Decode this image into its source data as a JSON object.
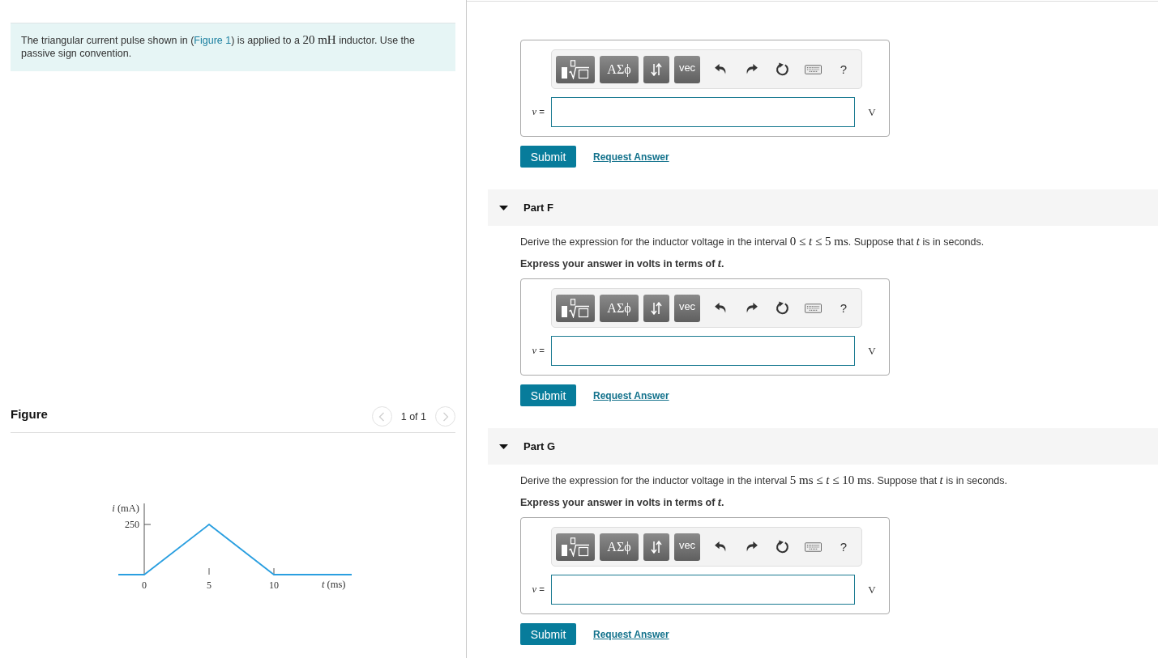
{
  "intro": {
    "segments": [
      {
        "kind": "text",
        "text": "The triangular current pulse shown in ("
      },
      {
        "kind": "link",
        "text": "Figure 1"
      },
      {
        "kind": "text",
        "text": ") is applied to a "
      },
      {
        "kind": "math",
        "text": "20 mH"
      },
      {
        "kind": "text",
        "text": " inductor. Use the passive sign convention."
      }
    ]
  },
  "figure": {
    "title": "Figure",
    "pager": {
      "label": "1 of 1",
      "prev_disabled": true,
      "next_disabled": true
    },
    "plot": {
      "ylabel": "*i* (mA)",
      "y_tick": "250",
      "x_ticks": [
        "0",
        "5",
        "10"
      ],
      "xlabel": "*t* (ms)"
    }
  },
  "top_answer": {
    "toolbar": {
      "symbols": "ΑΣϕ",
      "vector": "vec",
      "help": "?"
    },
    "variable": "*v* =",
    "unit": "V",
    "submit": "Submit",
    "request_answer": "Request Answer"
  },
  "parts": [
    {
      "title": "Part F",
      "expanded": true,
      "prompt": [
        {
          "kind": "text",
          "text": "Derive the expression for the inductor voltage in the interval "
        },
        {
          "kind": "math",
          "text": "0 ≤ *t* ≤ 5 ms"
        },
        {
          "kind": "text",
          "text": ". Suppose that "
        },
        {
          "kind": "math",
          "text": "*t*"
        },
        {
          "kind": "text",
          "text": " is in seconds."
        }
      ],
      "instruction": "Express your answer in volts in terms of *t*.",
      "answer": {
        "toolbar": {
          "symbols": "ΑΣϕ",
          "vector": "vec",
          "help": "?"
        },
        "variable": "*v* =",
        "unit": "V",
        "submit": "Submit",
        "request_answer": "Request Answer"
      }
    },
    {
      "title": "Part G",
      "expanded": true,
      "prompt": [
        {
          "kind": "text",
          "text": "Derive the expression for the inductor voltage in the interval "
        },
        {
          "kind": "math",
          "text": "5 ms ≤ *t* ≤ 10 ms"
        },
        {
          "kind": "text",
          "text": ". Suppose that "
        },
        {
          "kind": "math",
          "text": "*t*"
        },
        {
          "kind": "text",
          "text": " is in seconds."
        }
      ],
      "instruction": "Express your answer in volts in terms of *t*.",
      "answer": {
        "toolbar": {
          "symbols": "ΑΣϕ",
          "vector": "vec",
          "help": "?"
        },
        "variable": "*v* =",
        "unit": "V",
        "submit": "Submit",
        "request_answer": "Request Answer"
      }
    }
  ]
}
